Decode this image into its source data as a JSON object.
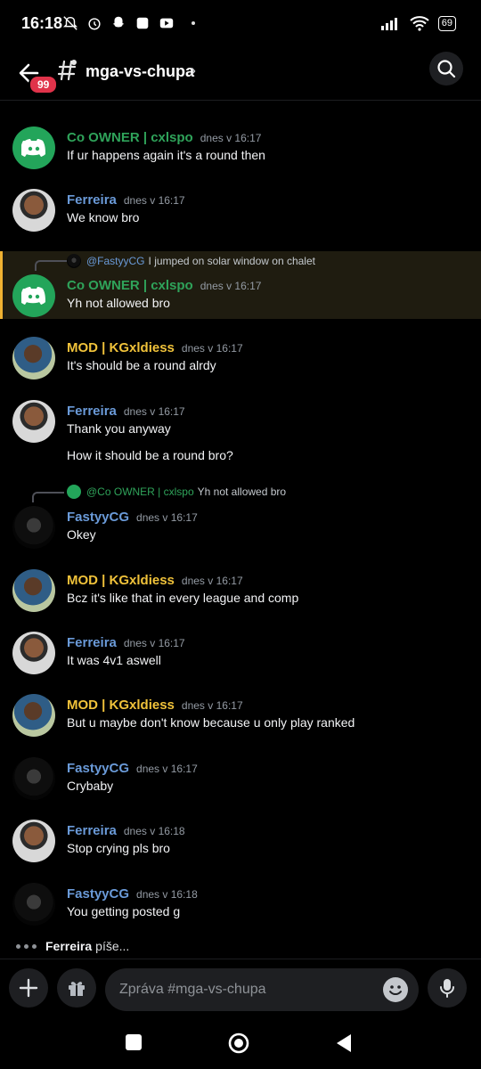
{
  "status": {
    "time": "16:18",
    "battery": "69"
  },
  "header": {
    "unread": "99",
    "channel": "mga-vs-chupa",
    "chevron": "›"
  },
  "messages": [
    {
      "name": "Co OWNER | cxlspo",
      "time": "dnes v 16:17",
      "text": "If ur happens again it's a round then"
    },
    {
      "name": "Ferreira",
      "time": "dnes v 16:17",
      "text": "We know bro"
    },
    {
      "reply_name": "@FastyyCG",
      "reply_text": "I jumped on solar window on chalet",
      "name": "Co OWNER | cxlspo",
      "time": "dnes v 16:17",
      "text": "Yh not allowed bro"
    },
    {
      "name": "MOD | KGxldiess",
      "time": "dnes v 16:17",
      "text": "It's should be a round alrdy"
    },
    {
      "name": "Ferreira",
      "time": "dnes v 16:17",
      "text": "Thank you anyway",
      "text2": "How it should be a round bro?"
    },
    {
      "reply_name": "@Co OWNER | cxlspo",
      "reply_text": "Yh not allowed bro",
      "name": "FastyyCG",
      "time": "dnes v 16:17",
      "text": "Okey"
    },
    {
      "name": "MOD | KGxldiess",
      "time": "dnes v 16:17",
      "text": "Bcz it's like that in every league and comp"
    },
    {
      "name": "Ferreira",
      "time": "dnes v 16:17",
      "text": "It was 4v1 aswell"
    },
    {
      "name": "MOD | KGxldiess",
      "time": "dnes v 16:17",
      "text": "But u maybe don't know because u only play ranked"
    },
    {
      "name": "FastyyCG",
      "time": "dnes v 16:17",
      "text": "Crybaby"
    },
    {
      "name": "Ferreira",
      "time": "dnes v 16:18",
      "text": "Stop crying pls bro"
    },
    {
      "name": "FastyyCG",
      "time": "dnes v 16:18",
      "text": "You getting posted g"
    }
  ],
  "typing": {
    "user": "Ferreira",
    "suffix": "píše..."
  },
  "composer": {
    "placeholder": "Zpráva #mga-vs-chupa"
  },
  "colors": {
    "owner": "#2fa35a",
    "member": "#6a9ad8",
    "mod": "#f0c23a",
    "highlight": "#f0b232"
  }
}
